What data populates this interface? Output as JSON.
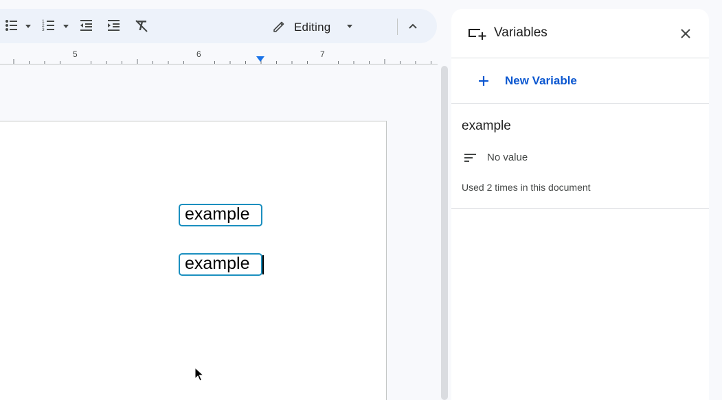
{
  "toolbar": {
    "mode_label": "Editing",
    "icons": [
      "bullet-list-icon",
      "numbered-list-icon",
      "decrease-indent-icon",
      "increase-indent-icon",
      "clear-formatting-icon",
      "pencil-icon",
      "collapse-toolbar-icon"
    ]
  },
  "ruler": {
    "numbers": [
      "5",
      "6",
      "7"
    ]
  },
  "document": {
    "chips": [
      "example",
      "example"
    ]
  },
  "panel": {
    "title": "Variables",
    "new_variable_label": "New Variable",
    "variable": {
      "name": "example",
      "value_label": "No value",
      "usage": "Used 2 times in this document"
    }
  },
  "colors": {
    "accent": "#0b57d0",
    "chip_border": "#1a8fbf",
    "toolbar_bg": "#edf2fa",
    "indent_marker": "#1a73e8"
  }
}
